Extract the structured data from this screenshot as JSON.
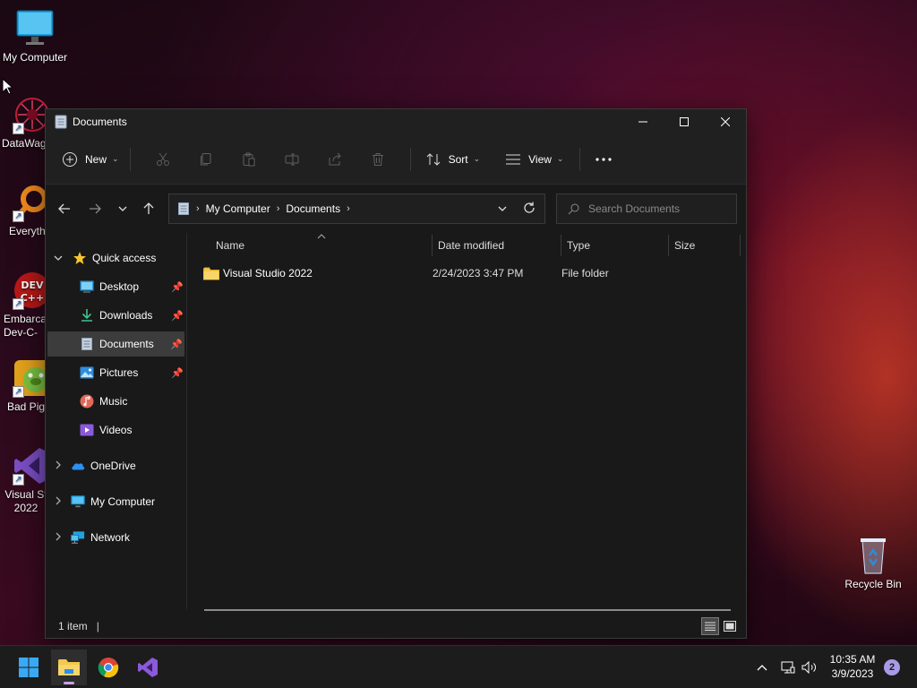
{
  "desktop": {
    "icons": [
      {
        "label": "My Computer",
        "icon": "monitor-icon"
      },
      {
        "label": "DataWag",
        "icon": "datawag-icon"
      },
      {
        "label": "Everyth",
        "icon": "everything-search-icon"
      },
      {
        "label": "Embarca Dev-C-",
        "icon": "devcpp-icon"
      },
      {
        "label": "Bad Pig",
        "icon": "bad-piggies-icon"
      },
      {
        "label": "Visual St 2022",
        "icon": "visual-studio-icon"
      },
      {
        "label": "Recycle Bin",
        "icon": "recycle-bin-icon"
      }
    ]
  },
  "window": {
    "title": "Documents",
    "controls": {
      "minimize": "minimize-icon",
      "maximize": "maximize-icon",
      "close": "close-icon"
    }
  },
  "toolbar": {
    "new_label": "New",
    "sort_label": "Sort",
    "view_label": "View",
    "icons": [
      "cut-icon",
      "copy-icon",
      "paste-icon",
      "rename-icon",
      "share-icon",
      "delete-icon"
    ]
  },
  "address": {
    "crumbs": [
      "My Computer",
      "Documents"
    ],
    "search_placeholder": "Search Documents"
  },
  "navpane": {
    "quick_access": "Quick access",
    "pinned": [
      {
        "label": "Desktop",
        "icon": "desktop-folder-icon",
        "pinned": true
      },
      {
        "label": "Downloads",
        "icon": "downloads-folder-icon",
        "pinned": true
      },
      {
        "label": "Documents",
        "icon": "documents-folder-icon",
        "pinned": true,
        "selected": true
      },
      {
        "label": "Pictures",
        "icon": "pictures-folder-icon",
        "pinned": true
      },
      {
        "label": "Music",
        "icon": "music-folder-icon",
        "pinned": false
      },
      {
        "label": "Videos",
        "icon": "videos-folder-icon",
        "pinned": false
      }
    ],
    "roots": [
      {
        "label": "OneDrive",
        "icon": "onedrive-icon"
      },
      {
        "label": "My Computer",
        "icon": "computer-icon"
      },
      {
        "label": "Network",
        "icon": "network-icon"
      }
    ]
  },
  "filelist": {
    "columns": [
      "Name",
      "Date modified",
      "Type",
      "Size"
    ],
    "rows": [
      {
        "name": "Visual Studio 2022",
        "date_modified": "2/24/2023 3:47 PM",
        "type": "File folder",
        "size": ""
      }
    ]
  },
  "status": {
    "item_count": "1 item"
  },
  "taskbar": {
    "apps": [
      "start-icon",
      "file-explorer-icon",
      "chrome-icon",
      "visual-studio-icon"
    ],
    "time": "10:35 AM",
    "date": "3/9/2023",
    "notifications": "2"
  },
  "colors": {
    "accent": "#60cdff",
    "folder": "#f2c94c",
    "selected_bg": "#3c3c3c",
    "window_bg": "#191919"
  }
}
